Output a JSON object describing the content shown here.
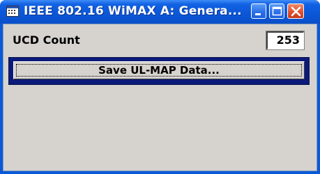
{
  "window": {
    "title": "IEEE 802.16 WiMAX A: Genera...",
    "controls": {
      "minimize": "minimize-icon",
      "maximize": "maximize-icon",
      "close": "close-icon"
    }
  },
  "ucd": {
    "label": "UCD Count",
    "value": "253"
  },
  "actions": {
    "save_ul_map_label": "Save UL-MAP Data..."
  },
  "colors": {
    "titlebar": "#0b56d6",
    "client": "#d6d3ce",
    "button_frame": "#0c1a7a",
    "close": "#e0512f"
  }
}
